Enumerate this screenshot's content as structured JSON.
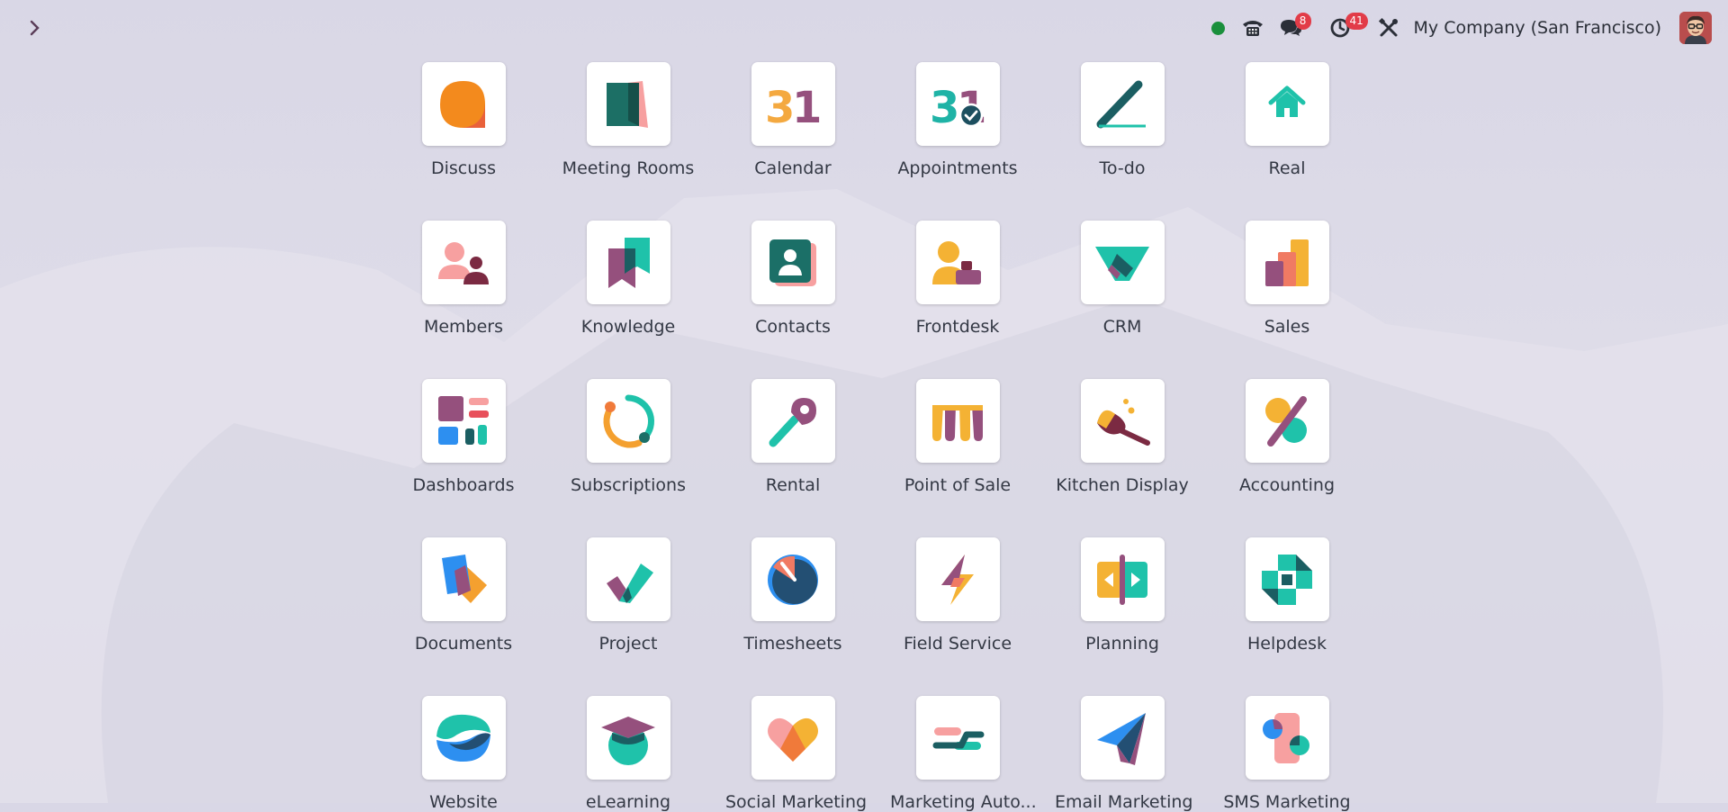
{
  "colors": {
    "background": "#dcdae6",
    "badge": "#e23c48",
    "presence": "#1a8f3c",
    "text": "#333844"
  },
  "topbar": {
    "menu_icon": "chevron-right-icon",
    "messages_count": "8",
    "activities_count": "41",
    "company": "My Company (San Francisco)"
  },
  "apps": [
    {
      "label": "Discuss",
      "icon": "discuss-icon"
    },
    {
      "label": "Meeting Rooms",
      "icon": "meeting-rooms-icon"
    },
    {
      "label": "Calendar",
      "icon": "calendar-icon"
    },
    {
      "label": "Appointments",
      "icon": "appointments-icon"
    },
    {
      "label": "To-do",
      "icon": "todo-icon"
    },
    {
      "label": "Real",
      "icon": "real-estate-icon"
    },
    {
      "label": "Members",
      "icon": "members-icon"
    },
    {
      "label": "Knowledge",
      "icon": "knowledge-icon"
    },
    {
      "label": "Contacts",
      "icon": "contacts-icon"
    },
    {
      "label": "Frontdesk",
      "icon": "frontdesk-icon"
    },
    {
      "label": "CRM",
      "icon": "crm-icon"
    },
    {
      "label": "Sales",
      "icon": "sales-icon"
    },
    {
      "label": "Dashboards",
      "icon": "dashboards-icon"
    },
    {
      "label": "Subscriptions",
      "icon": "subscriptions-icon"
    },
    {
      "label": "Rental",
      "icon": "rental-icon"
    },
    {
      "label": "Point of Sale",
      "icon": "point-of-sale-icon"
    },
    {
      "label": "Kitchen Display",
      "icon": "kitchen-display-icon"
    },
    {
      "label": "Accounting",
      "icon": "accounting-icon"
    },
    {
      "label": "Documents",
      "icon": "documents-icon"
    },
    {
      "label": "Project",
      "icon": "project-icon"
    },
    {
      "label": "Timesheets",
      "icon": "timesheets-icon"
    },
    {
      "label": "Field Service",
      "icon": "field-service-icon"
    },
    {
      "label": "Planning",
      "icon": "planning-icon"
    },
    {
      "label": "Helpdesk",
      "icon": "helpdesk-icon"
    },
    {
      "label": "Website",
      "icon": "website-icon"
    },
    {
      "label": "eLearning",
      "icon": "elearning-icon"
    },
    {
      "label": "Social Marketing",
      "icon": "social-marketing-icon"
    },
    {
      "label": "Marketing Auto...",
      "icon": "marketing-automation-icon"
    },
    {
      "label": "Email Marketing",
      "icon": "email-marketing-icon"
    },
    {
      "label": "SMS Marketing",
      "icon": "sms-marketing-icon"
    }
  ]
}
